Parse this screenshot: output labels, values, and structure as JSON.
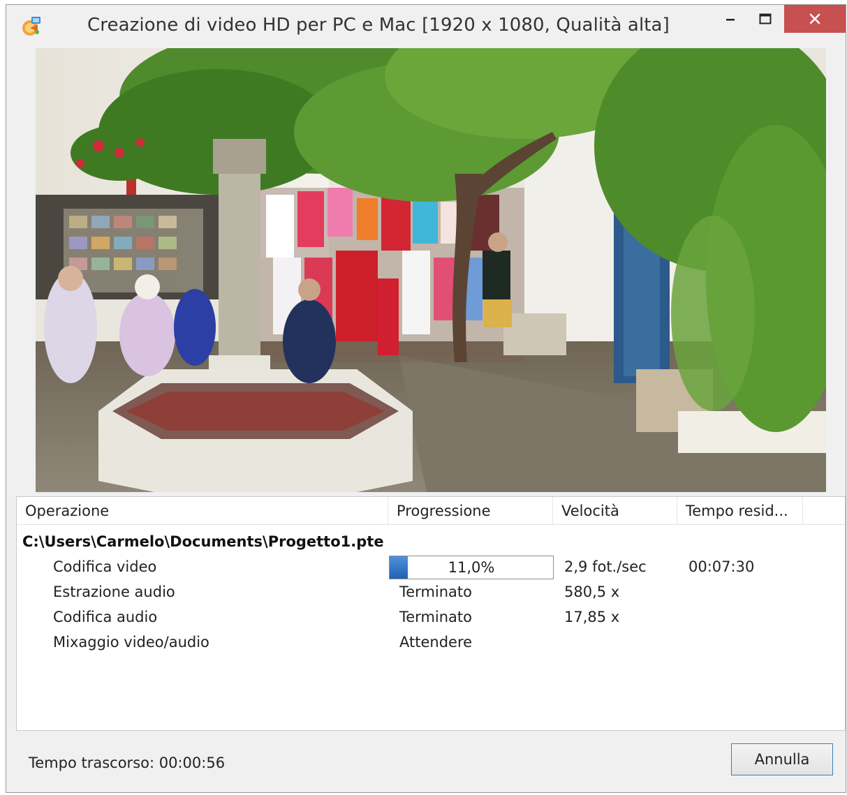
{
  "window": {
    "title": "Creazione di video HD per PC e Mac  [1920 x 1080, Qualità alta]",
    "icon": "app-icon",
    "controls": {
      "minimize_icon": "minimize-icon",
      "maximize_icon": "maximize-icon",
      "close_icon": "close-icon"
    }
  },
  "preview": {
    "description_icon": "preview-image"
  },
  "table": {
    "columns": [
      "Operazione",
      "Progressione",
      "Velocità",
      "Tempo resid..."
    ],
    "project_path": "C:\\Users\\Carmelo\\Documents\\Progetto1.pte",
    "rows": [
      {
        "operation": "Codifica video",
        "progress": "11,0%",
        "speed": "2,9 fot./sec",
        "remaining": "00:07:30"
      },
      {
        "operation": "Estrazione audio",
        "progress": "Terminato",
        "speed": "580,5 x",
        "remaining": ""
      },
      {
        "operation": "Codifica audio",
        "progress": "Terminato",
        "speed": "17,85 x",
        "remaining": ""
      },
      {
        "operation": "Mixaggio video/audio",
        "progress": "Attendere",
        "speed": "",
        "remaining": ""
      }
    ],
    "progress_fraction": 0.11
  },
  "footer": {
    "elapsed": "Tempo trascorso: 00:00:56",
    "cancel_label": "Annulla"
  },
  "colors": {
    "close_button": "#c75050",
    "progress_fill": "#2a6fc0",
    "button_border": "#3c7fb1"
  }
}
